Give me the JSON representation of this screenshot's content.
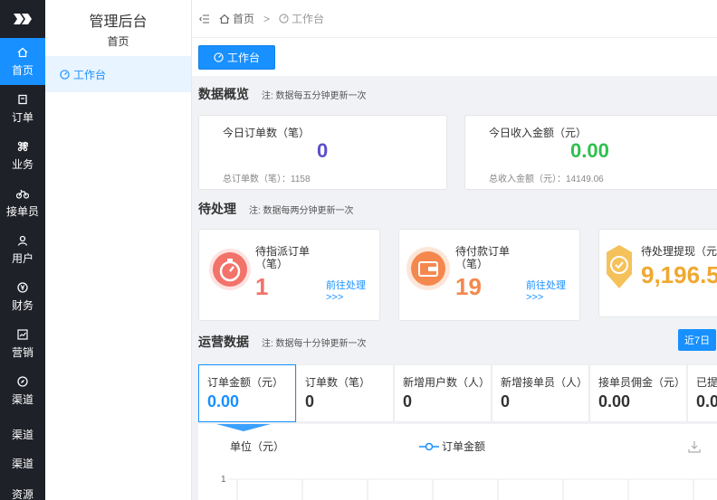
{
  "sidebar": {
    "items": [
      {
        "label": "首页",
        "icon": "home-icon",
        "active": true
      },
      {
        "label": "订单",
        "icon": "order-icon"
      },
      {
        "label": "业务",
        "icon": "command-icon"
      },
      {
        "label": "接单员",
        "icon": "bike-icon"
      },
      {
        "label": "用户",
        "icon": "user-icon"
      },
      {
        "label": "财务",
        "icon": "money-icon"
      },
      {
        "label": "营销",
        "icon": "trend-icon"
      },
      {
        "label": "渠道",
        "icon": "compass-icon"
      }
    ],
    "extra": [
      "渠道",
      "渠道",
      "资源"
    ]
  },
  "submenu": {
    "title": "管理后台",
    "subtitle": "首页",
    "item": "工作台"
  },
  "breadcrumb": {
    "home": "首页",
    "sep": ">",
    "current": "工作台"
  },
  "tab": {
    "label": "工作台"
  },
  "overview": {
    "title": "数据概览",
    "note": "注: 数据每五分钟更新一次",
    "cards": [
      {
        "label": "今日订单数（笔）",
        "value": "0",
        "foot": "总订单数（笔）：1158",
        "color": "#5b4fc9"
      },
      {
        "label": "今日收入金额（元）",
        "value": "0.00",
        "foot": "总收入金额（元）：14149.06",
        "color": "#2fbf4e"
      }
    ]
  },
  "pending": {
    "title": "待处理",
    "note": "注: 数据每两分钟更新一次",
    "cards": [
      {
        "label1": "待指派订单",
        "label2": "（笔）",
        "value": "1",
        "link1": "前往处理",
        "link2": ">>>",
        "icon": "stopwatch-icon",
        "color": "#f2736a"
      },
      {
        "label1": "待付款订单",
        "label2": "（笔）",
        "value": "19",
        "link1": "前往处理",
        "link2": ">>>",
        "icon": "wallet-icon",
        "color": "#f5884e"
      },
      {
        "label1": "待处理提现（元）",
        "label2": "",
        "value": "9,196.5",
        "icon": "badge-icon",
        "color": "#f0a830"
      }
    ]
  },
  "operations": {
    "title": "运营数据",
    "note": "注: 数据每十分钟更新一次",
    "range": "近7日",
    "tiles": [
      {
        "label": "订单金额（元）",
        "value": "0.00",
        "active": true
      },
      {
        "label": "订单数（笔）",
        "value": "0"
      },
      {
        "label": "新增用户数（人）",
        "value": "0"
      },
      {
        "label": "新增接单员（人）",
        "value": "0"
      },
      {
        "label": "接单员佣金（元）",
        "value": "0.00"
      },
      {
        "label": "已提",
        "value": "0.0"
      }
    ]
  },
  "chart_data": {
    "type": "line",
    "ylabel": "单位（元）",
    "legend": "订单金额",
    "legend_placement": "top-center",
    "y_ticks": [
      "1"
    ],
    "series": [
      {
        "name": "订单金额",
        "values": []
      }
    ]
  }
}
